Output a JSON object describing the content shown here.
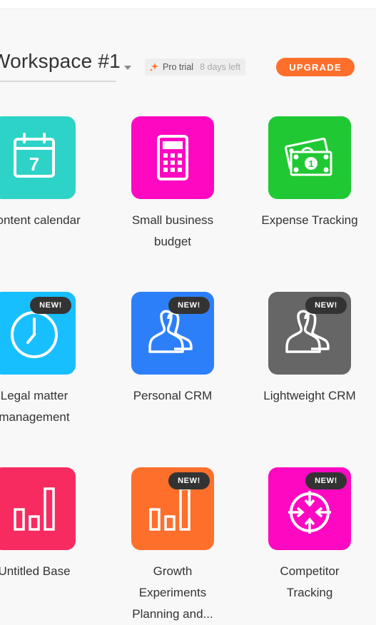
{
  "header": {
    "workspace_title": "Workspace #1",
    "pro_trial_label": "Pro trial",
    "days_left_label": "8 days left",
    "upgrade_label": "UPGRADE"
  },
  "tiles": [
    {
      "label_line1": "Content calendar",
      "label_line2": "",
      "label_line3": "",
      "color": "#2dd3c7",
      "icon": "calendar-icon",
      "is_new": false
    },
    {
      "label_line1": "Small business",
      "label_line2": "budget",
      "label_line3": "",
      "color": "#ff08c2",
      "icon": "calculator-icon",
      "is_new": false
    },
    {
      "label_line1": "Expense Tracking",
      "label_line2": "",
      "label_line3": "",
      "color": "#20c933",
      "icon": "money-icon",
      "is_new": false
    },
    {
      "label_line1": "Legal matter",
      "label_line2": "management",
      "label_line3": "",
      "color": "#18bfff",
      "icon": "clock-icon",
      "is_new": true
    },
    {
      "label_line1": "Personal CRM",
      "label_line2": "",
      "label_line3": "",
      "color": "#2d7ff9",
      "icon": "users-icon",
      "is_new": true
    },
    {
      "label_line1": "Lightweight CRM",
      "label_line2": "",
      "label_line3": "",
      "color": "#666666",
      "icon": "users-icon",
      "is_new": true
    },
    {
      "label_line1": "Untitled Base",
      "label_line2": "",
      "label_line3": "",
      "color": "#f82b60",
      "icon": "bar-chart-icon",
      "is_new": false
    },
    {
      "label_line1": "Growth",
      "label_line2": "Experiments",
      "label_line3": "Planning and...",
      "color": "#ff6f2c",
      "icon": "bar-chart-icon",
      "is_new": true
    },
    {
      "label_line1": "Competitor",
      "label_line2": "Tracking",
      "label_line3": "",
      "color": "#ff08c2",
      "icon": "target-icon",
      "is_new": true
    }
  ],
  "new_badge_label": "NEW!"
}
